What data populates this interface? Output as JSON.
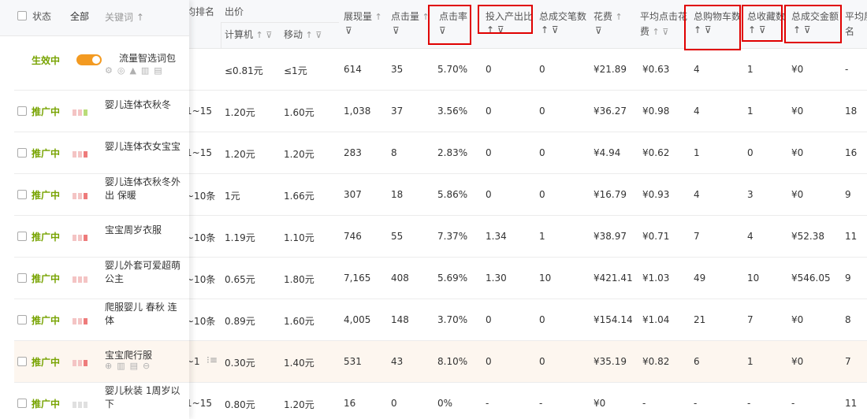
{
  "headers": {
    "status": "状态",
    "all": "全部",
    "keyword": "关键词",
    "keyword_sort": "↑",
    "rank": "均排名",
    "bid": "出价",
    "bid_pc": "计算机",
    "bid_mobile": "移动",
    "impressions": "展现量",
    "clicks": "点击量",
    "ctr": "点击率",
    "roi": "投入产出比",
    "total_trans": "总成交笔数",
    "cost": "花费",
    "avg_cpc_l1": "平均点击花",
    "avg_cpc_l2": "费",
    "total_cart": "总购物车数",
    "total_fav": "总收藏数",
    "total_amount": "总成交金额",
    "avg_rank_l1": "平均展",
    "avg_rank_l2": "名",
    "sort_icon": "↑",
    "filter_icon": "⊽"
  },
  "package_row": {
    "status": "生效中",
    "toggle_on": true,
    "keyword": "流量智选词包",
    "rank": "",
    "bid_pc": "≤0.81元",
    "bid_mobile": "≤1元",
    "impressions": "614",
    "clicks": "35",
    "ctr": "5.70%",
    "roi": "0",
    "total_trans": "0",
    "cost": "¥21.89",
    "avg_cpc": "¥0.63",
    "total_cart": "4",
    "total_fav": "1",
    "total_amount": "¥0",
    "avg_rank": "-"
  },
  "rows": [
    {
      "status": "推广中",
      "keyword": "婴儿连体衣秋冬",
      "rank": "1~15",
      "bid_pc": "1.20元",
      "bid_mobile": "1.60元",
      "impressions": "1,038",
      "clicks": "37",
      "ctr": "3.56%",
      "roi": "0",
      "total_trans": "0",
      "cost": "¥36.27",
      "avg_cpc": "¥0.98",
      "total_cart": "4",
      "total_fav": "1",
      "total_amount": "¥0",
      "avg_rank": "18",
      "bars": [
        "#f4c4c4",
        "#f4c4c4",
        "#b9dc79"
      ]
    },
    {
      "status": "推广中",
      "keyword": "婴儿连体衣女宝宝",
      "rank": "1~15",
      "bid_pc": "1.20元",
      "bid_mobile": "1.20元",
      "impressions": "283",
      "clicks": "8",
      "ctr": "2.83%",
      "roi": "0",
      "total_trans": "0",
      "cost": "¥4.94",
      "avg_cpc": "¥0.62",
      "total_cart": "1",
      "total_fav": "0",
      "total_amount": "¥0",
      "avg_rank": "16",
      "bars": [
        "#f4c4c4",
        "#f4c4c4",
        "#ee7b7b"
      ]
    },
    {
      "status": "推广中",
      "keyword": "婴儿连体衣秋冬外出 保暖",
      "rank": "~10条",
      "bid_pc": "1元",
      "bid_mobile": "1.66元",
      "impressions": "307",
      "clicks": "18",
      "ctr": "5.86%",
      "roi": "0",
      "total_trans": "0",
      "cost": "¥16.79",
      "avg_cpc": "¥0.93",
      "total_cart": "4",
      "total_fav": "3",
      "total_amount": "¥0",
      "avg_rank": "9",
      "bars": [
        "#f4c4c4",
        "#f4c4c4",
        "#ee7b7b"
      ]
    },
    {
      "status": "推广中",
      "keyword": "宝宝周岁衣服",
      "rank": "~10条",
      "bid_pc": "1.19元",
      "bid_mobile": "1.10元",
      "impressions": "746",
      "clicks": "55",
      "ctr": "7.37%",
      "roi": "1.34",
      "total_trans": "1",
      "cost": "¥38.97",
      "avg_cpc": "¥0.71",
      "total_cart": "7",
      "total_fav": "4",
      "total_amount": "¥52.38",
      "avg_rank": "11",
      "bars": [
        "#f4c4c4",
        "#f4c4c4",
        "#ee7b7b"
      ]
    },
    {
      "status": "推广中",
      "keyword": "婴儿外套可爱超萌公主",
      "rank": "~10条",
      "bid_pc": "0.65元",
      "bid_mobile": "1.80元",
      "impressions": "7,165",
      "clicks": "408",
      "ctr": "5.69%",
      "roi": "1.30",
      "total_trans": "10",
      "cost": "¥421.41",
      "avg_cpc": "¥1.03",
      "total_cart": "49",
      "total_fav": "10",
      "total_amount": "¥546.05",
      "avg_rank": "9",
      "bars": [
        "#f4c4c4",
        "#f4c4c4",
        "#f4c4c4"
      ]
    },
    {
      "status": "推广中",
      "keyword": "爬服婴儿 春秋 连体",
      "rank": "~10条",
      "bid_pc": "0.89元",
      "bid_mobile": "1.60元",
      "impressions": "4,005",
      "clicks": "148",
      "ctr": "3.70%",
      "roi": "0",
      "total_trans": "0",
      "cost": "¥154.14",
      "avg_cpc": "¥1.04",
      "total_cart": "21",
      "total_fav": "7",
      "total_amount": "¥0",
      "avg_rank": "8",
      "bars": [
        "#f4c4c4",
        "#f4c4c4",
        "#ee7b7b"
      ]
    },
    {
      "status": "推广中",
      "keyword": "宝宝爬行服",
      "rank": "~1",
      "bid_pc": "0.30元",
      "bid_mobile": "1.40元",
      "impressions": "531",
      "clicks": "43",
      "ctr": "8.10%",
      "roi": "0",
      "total_trans": "0",
      "cost": "¥35.19",
      "avg_cpc": "¥0.82",
      "total_cart": "6",
      "total_fav": "1",
      "total_amount": "¥0",
      "avg_rank": "7",
      "bars": [
        "#f4c4c4",
        "#f4c4c4",
        "#ee7b7b"
      ]
    },
    {
      "status": "推广中",
      "keyword": "婴儿秋装 1周岁以下",
      "rank": "1~15",
      "bid_pc": "0.80元",
      "bid_mobile": "1.20元",
      "impressions": "16",
      "clicks": "0",
      "ctr": "0%",
      "roi": "-",
      "total_trans": "-",
      "cost": "¥0",
      "avg_cpc": "-",
      "total_cart": "-",
      "total_fav": "-",
      "total_amount": "-",
      "avg_rank": "11",
      "bars": [
        "#e0e0e0",
        "#e0e0e0",
        "#e0e0e0"
      ]
    }
  ],
  "colors": {
    "status_green": "#77a300",
    "toggle_orange": "#f39a21",
    "highlight_red": "#e00000"
  }
}
